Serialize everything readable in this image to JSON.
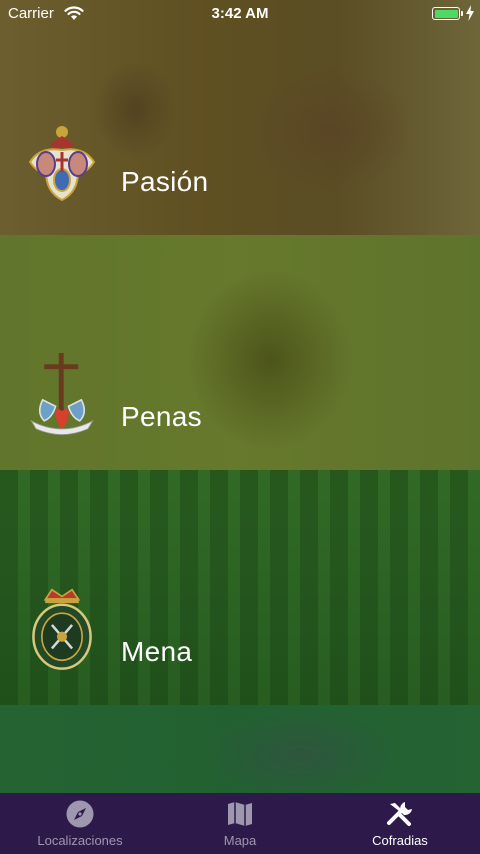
{
  "status_bar": {
    "carrier": "Carrier",
    "time": "3:42 AM",
    "battery_color": "#4cd964"
  },
  "rows": [
    {
      "label": "Pasión",
      "crest_icon": "pasion-crest-icon",
      "overlay_color": "#6e641e"
    },
    {
      "label": "Penas",
      "crest_icon": "penas-crest-icon",
      "overlay_color": "#507814"
    },
    {
      "label": "Mena",
      "crest_icon": "mena-crest-icon",
      "overlay_color": "#146e14"
    }
  ],
  "tab_bar": {
    "background": "#2d1a4a",
    "tabs": [
      {
        "label": "Localizaciones",
        "icon": "compass-icon",
        "active": false
      },
      {
        "label": "Mapa",
        "icon": "map-icon",
        "active": false
      },
      {
        "label": "Cofradias",
        "icon": "tools-icon",
        "active": true
      }
    ]
  }
}
